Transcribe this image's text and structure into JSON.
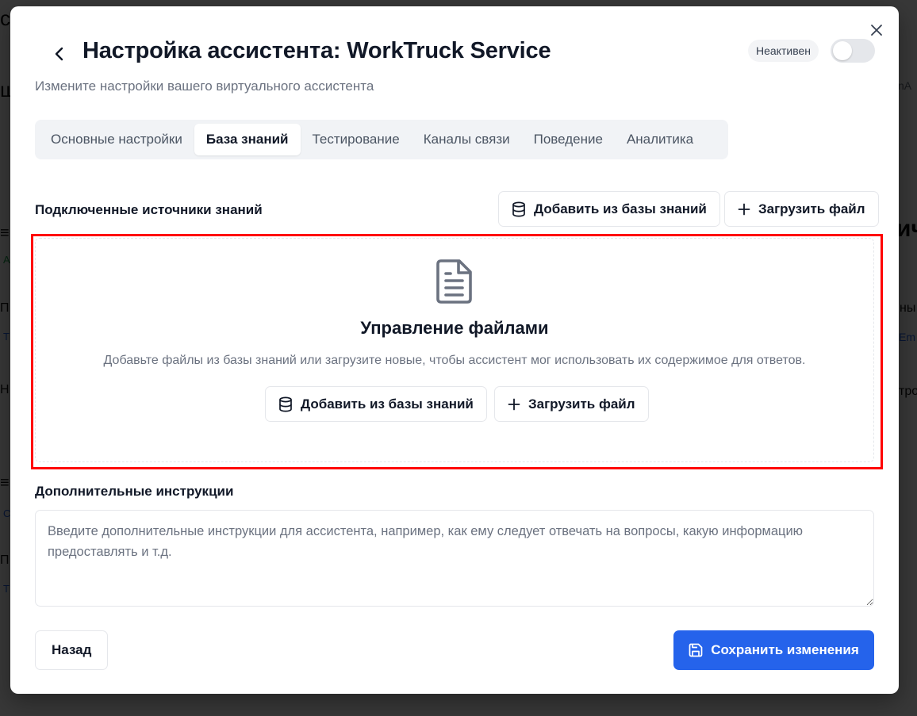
{
  "dialog": {
    "title": "Настройка ассистента: WorkTruck Service",
    "subtitle": "Измените настройки вашего виртуального ассистента",
    "status": "Неактивен",
    "toggle_on": false
  },
  "tabs": [
    {
      "label": "Основные настройки",
      "active": false
    },
    {
      "label": "База знаний",
      "active": true
    },
    {
      "label": "Тестирование",
      "active": false
    },
    {
      "label": "Каналы связи",
      "active": false
    },
    {
      "label": "Поведение",
      "active": false
    },
    {
      "label": "Аналитика",
      "active": false
    }
  ],
  "sources": {
    "heading": "Подключенные источники знаний",
    "add_from_kb_label": "Добавить из базы знаний",
    "upload_label": "Загрузить файл"
  },
  "empty_state": {
    "title": "Управление файлами",
    "description": "Добавьте файлы из базы знаний или загрузите новые, чтобы ассистент мог использовать их содержимое для ответов.",
    "add_from_kb_label": "Добавить из базы знаний",
    "upload_label": "Загрузить файл"
  },
  "instructions": {
    "heading": "Дополнительные инструкции",
    "value": "",
    "placeholder": "Введите дополнительные инструкции для ассистента, например, как ему следует отвечать на вопросы, какую информацию предоставлять и т.д."
  },
  "footer": {
    "back_label": "Назад",
    "save_label": "Сохранить изменения"
  },
  "colors": {
    "primary": "#2563eb",
    "highlight": "#ff0000",
    "muted_text": "#6b7280",
    "border": "#e5e7eb"
  }
}
